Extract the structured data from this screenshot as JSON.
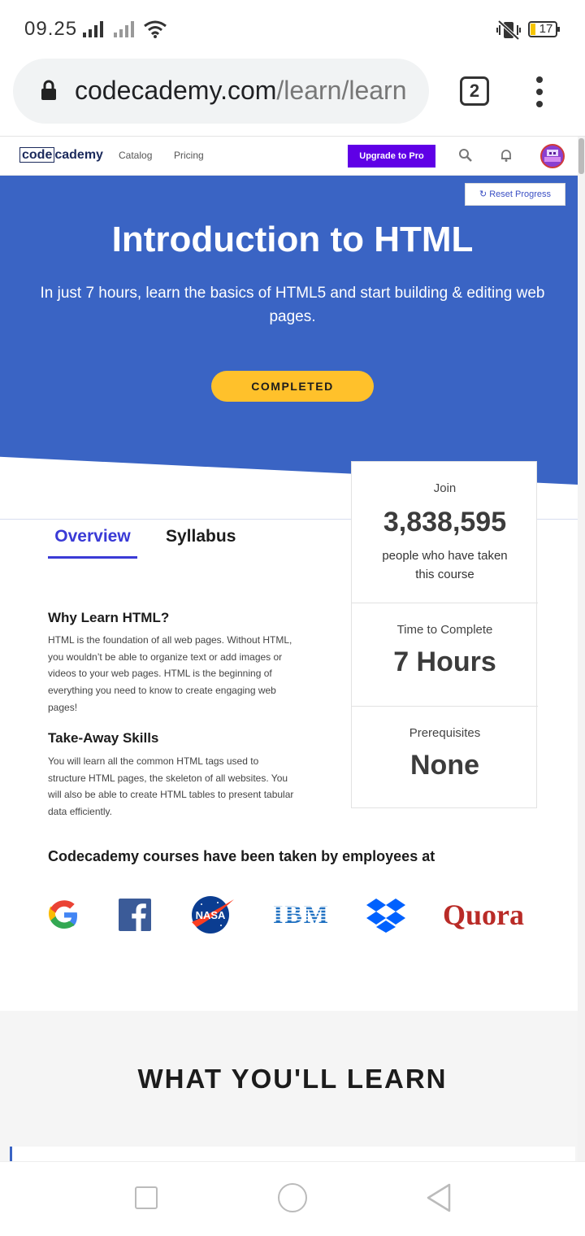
{
  "status_bar": {
    "time": "09.25",
    "battery": "17"
  },
  "browser": {
    "url_domain": "codecademy.com",
    "url_path": "/learn/learn",
    "tab_count": "2"
  },
  "site_nav": {
    "logo_code": "code",
    "logo_cademy": "cademy",
    "catalog": "Catalog",
    "pricing": "Pricing",
    "upgrade": "Upgrade to Pro"
  },
  "hero": {
    "reset_label": "Reset Progress",
    "title": "Introduction to HTML",
    "subtitle": "In just 7 hours, learn the basics of HTML5 and start building & editing web pages.",
    "status_button": "COMPLETED",
    "colors": {
      "background": "#3a64c4",
      "button": "#ffc12b"
    }
  },
  "tabs": [
    {
      "label": "Overview",
      "active": true
    },
    {
      "label": "Syllabus",
      "active": false
    }
  ],
  "stats": {
    "join_label": "Join",
    "learners": "3,838,595",
    "learners_desc": "people who have taken this course",
    "time_label": "Time to Complete",
    "time_value": "7 Hours",
    "prereq_label": "Prerequisites",
    "prereq_value": "None"
  },
  "overview": {
    "why_title": "Why Learn HTML?",
    "why_text": "HTML is the foundation of all web pages. Without HTML, you wouldn’t be able to organize text or add images or videos to your web pages. HTML is the beginning of everything you need to know to create engaging web pages!",
    "skills_title": "Take-Away Skills",
    "skills_text": "You will learn all the common HTML tags used to structure HTML pages, the skeleton of all websites. You will also be able to create HTML tables to present tabular data efficiently."
  },
  "employers": {
    "title": "Codecademy courses have been taken by employees at",
    "logos": [
      "google-logo",
      "facebook-logo",
      "nasa-logo",
      "ibm-logo",
      "dropbox-logo",
      "quora-logo"
    ],
    "nasa_text": "NASA",
    "ibm_text": "IBM",
    "quora_text": "Quora"
  },
  "learn_section": {
    "title": "WHAT YOU'LL LEARN"
  }
}
